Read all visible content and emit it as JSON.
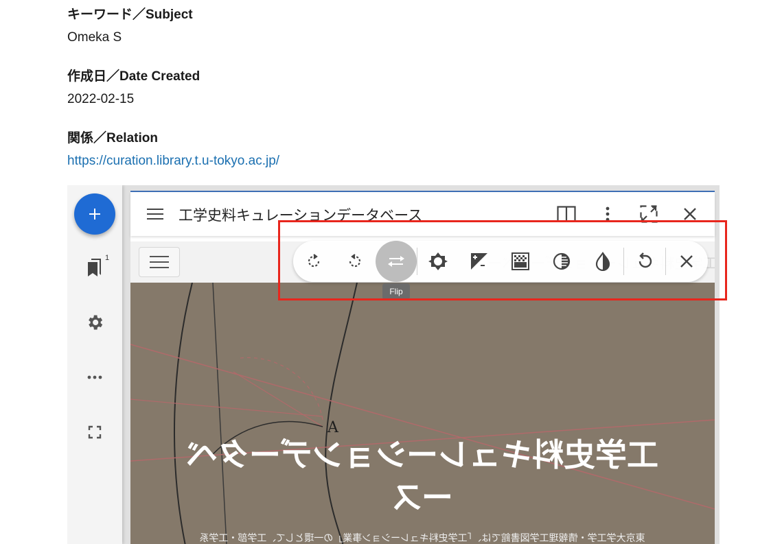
{
  "metadata": [
    {
      "label": "キーワード／Subject",
      "value": "Omeka S"
    },
    {
      "label": "作成日／Date Created",
      "value": "2022-02-15"
    },
    {
      "label": "関係／Relation",
      "value": "https://curation.library.t.u-tokyo.ac.jp/"
    }
  ],
  "viewer": {
    "add_icon": "plus-icon",
    "bookmark_count": "1",
    "window_title": "工学史料キュレーションデータベース",
    "hero_title": "工学史料キュレーションデータベース",
    "hero_subtitle": "東京大学工学・情報理工学図書館では、「工学史料キュレーション事業」の一環として、工学部・工学系",
    "tooltip": "Flip",
    "tools": [
      {
        "name": "rotate-right-icon"
      },
      {
        "name": "rotate-left-icon"
      },
      {
        "name": "flip-icon",
        "active": true
      },
      {
        "name": "brightness-icon"
      },
      {
        "name": "contrast-icon"
      },
      {
        "name": "saturation-icon"
      },
      {
        "name": "grayscale-icon"
      },
      {
        "name": "invert-icon"
      },
      {
        "name": "revert-icon"
      },
      {
        "name": "close-icon"
      }
    ]
  },
  "colors": {
    "accent": "#1f6bd4",
    "link": "#1a6fb0",
    "highlight": "#e8261d",
    "hero_bg": "#85796a"
  }
}
